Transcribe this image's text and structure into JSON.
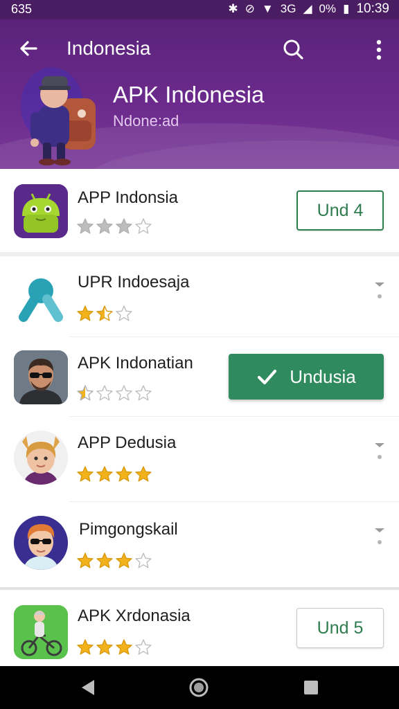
{
  "status_bar": {
    "left_text": "635",
    "battery_text": "0%",
    "signal_text": "3G",
    "time": "10:39"
  },
  "toolbar": {
    "title": "Indonesia",
    "back_icon": "arrow-left-icon",
    "search_icon": "search-icon",
    "more_icon": "more-vert-icon"
  },
  "header": {
    "title": "APK Indonesia",
    "subtitle": "Ndone:ad"
  },
  "apps": [
    {
      "name": "APP Indonsia",
      "rating": 3,
      "max": 4,
      "action": "Und 4",
      "action_style": "outline"
    },
    {
      "name": "UPR Indoesaja",
      "rating": 1.5,
      "max": 3,
      "action": null
    },
    {
      "name": "APK Indonatian",
      "rating": 0.5,
      "max": 4,
      "action": "Undusia",
      "action_style": "filled"
    },
    {
      "name": "APP Dedusia",
      "rating": 4,
      "max": 4,
      "action": null
    },
    {
      "name": "Pimgongskail",
      "rating": 3,
      "max": 4,
      "action": null
    },
    {
      "name": "APK Xrdonasia",
      "rating": 3,
      "max": 4,
      "action": "Und 5",
      "action_style": "outline-gray"
    }
  ],
  "colors": {
    "header_purple": "#5a2379",
    "accent_green": "#2f8a5d",
    "star_gold": "#f2b21c",
    "star_gray": "#bdbdbd"
  },
  "nav": {
    "back_icon": "nav-back-icon",
    "home_icon": "nav-home-icon",
    "recents_icon": "nav-recents-icon"
  }
}
